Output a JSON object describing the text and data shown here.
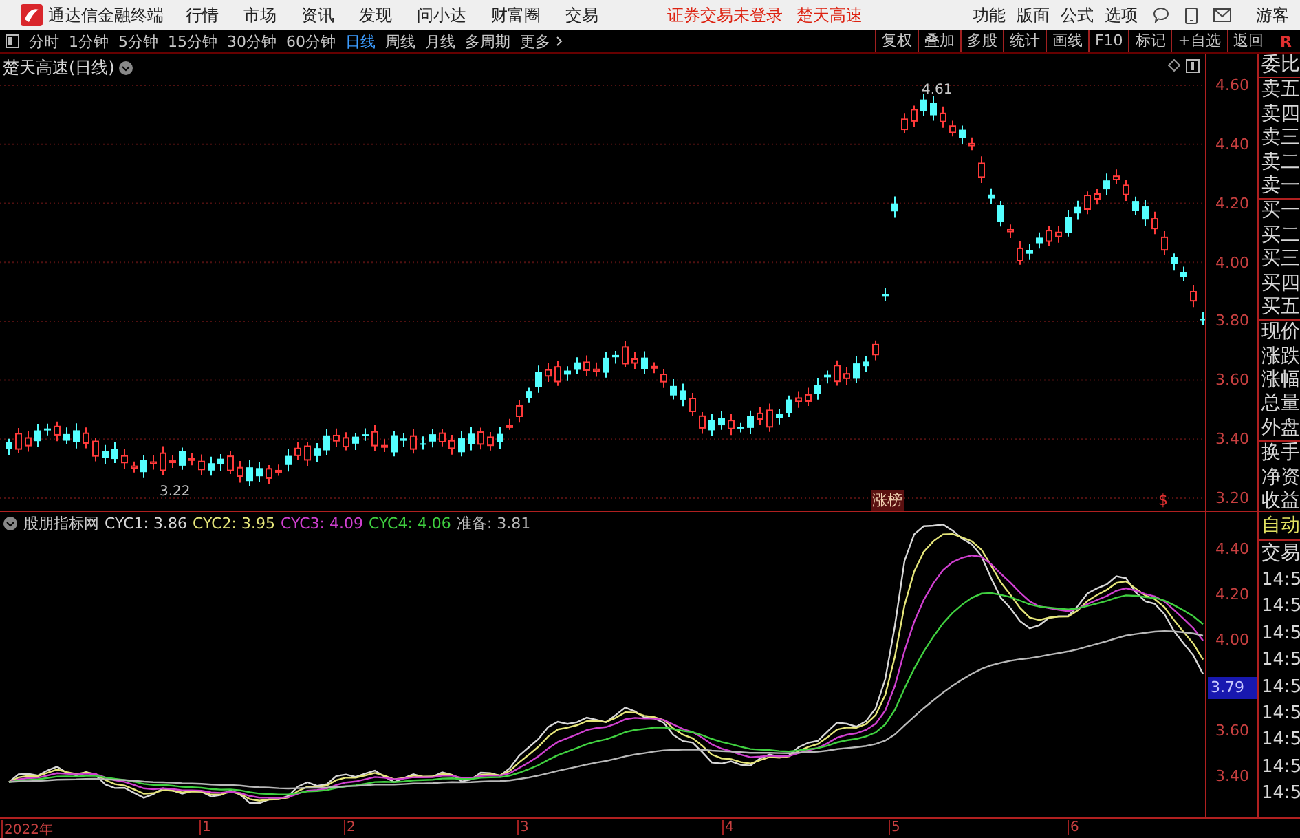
{
  "app": {
    "title": "通达信金融终端"
  },
  "menu": [
    "行情",
    "市场",
    "资讯",
    "发现",
    "问小达",
    "财富圈",
    "交易"
  ],
  "notices": [
    "证券交易未登录",
    "楚天高速"
  ],
  "right_menu": [
    "功能",
    "版面",
    "公式",
    "选项"
  ],
  "user": "游客",
  "periods": [
    {
      "label": "分时",
      "selected": false
    },
    {
      "label": "1分钟",
      "selected": false
    },
    {
      "label": "5分钟",
      "selected": false
    },
    {
      "label": "15分钟",
      "selected": false
    },
    {
      "label": "30分钟",
      "selected": false
    },
    {
      "label": "60分钟",
      "selected": false
    },
    {
      "label": "日线",
      "selected": true
    },
    {
      "label": "周线",
      "selected": false
    },
    {
      "label": "月线",
      "selected": false
    },
    {
      "label": "多周期",
      "selected": false
    },
    {
      "label": "更多",
      "selected": false
    }
  ],
  "tool_buttons": [
    "复权",
    "叠加",
    "多股",
    "统计",
    "画线",
    "F10",
    "标记",
    "+自选",
    "返回"
  ],
  "corner_mark": "R",
  "main_chart": {
    "title": "楚天高速(日线)",
    "price_ticks": [
      "4.60",
      "4.40",
      "4.20",
      "4.00",
      "3.80",
      "3.60",
      "3.40",
      "3.20"
    ],
    "low_label": "3.22",
    "high_label": "4.61",
    "markers": [
      {
        "text": "涨榜",
        "kind": "tag"
      },
      {
        "text": "$",
        "kind": "flag"
      }
    ]
  },
  "indicator": {
    "name": "股朋指标网",
    "series": [
      {
        "label": "CYC1:",
        "value": "3.86",
        "color": "#d8d8d8"
      },
      {
        "label": "CYC2:",
        "value": "3.95",
        "color": "#e6e67a"
      },
      {
        "label": "CYC3:",
        "value": "4.09",
        "color": "#d040d0"
      },
      {
        "label": "CYC4:",
        "value": "4.06",
        "color": "#40d040"
      },
      {
        "label": "准备:",
        "value": "3.81",
        "color": "#b8b8b8"
      }
    ],
    "ticks": [
      "4.40",
      "4.20",
      "4.00",
      "3.60",
      "3.40"
    ],
    "current": "3.79"
  },
  "quote_groups": [
    [
      "委比"
    ],
    [
      "卖五",
      "卖四",
      "卖三",
      "卖二",
      "卖一"
    ],
    [
      "买一",
      "买二",
      "买三",
      "买四",
      "买五"
    ],
    [
      "现价",
      "涨跌",
      "涨幅",
      "总量",
      "外盘"
    ],
    [
      "换手",
      "净资",
      "收益"
    ]
  ],
  "trade_panel": {
    "mode": "自动",
    "title": "交易",
    "times": [
      "14:5",
      "14:5",
      "14:5",
      "14:5",
      "14:5",
      "14:5",
      "14:5",
      "14:5",
      "14:5"
    ]
  },
  "time_axis": [
    "2022年",
    "1",
    "2",
    "3",
    "4",
    "5",
    "6"
  ]
}
